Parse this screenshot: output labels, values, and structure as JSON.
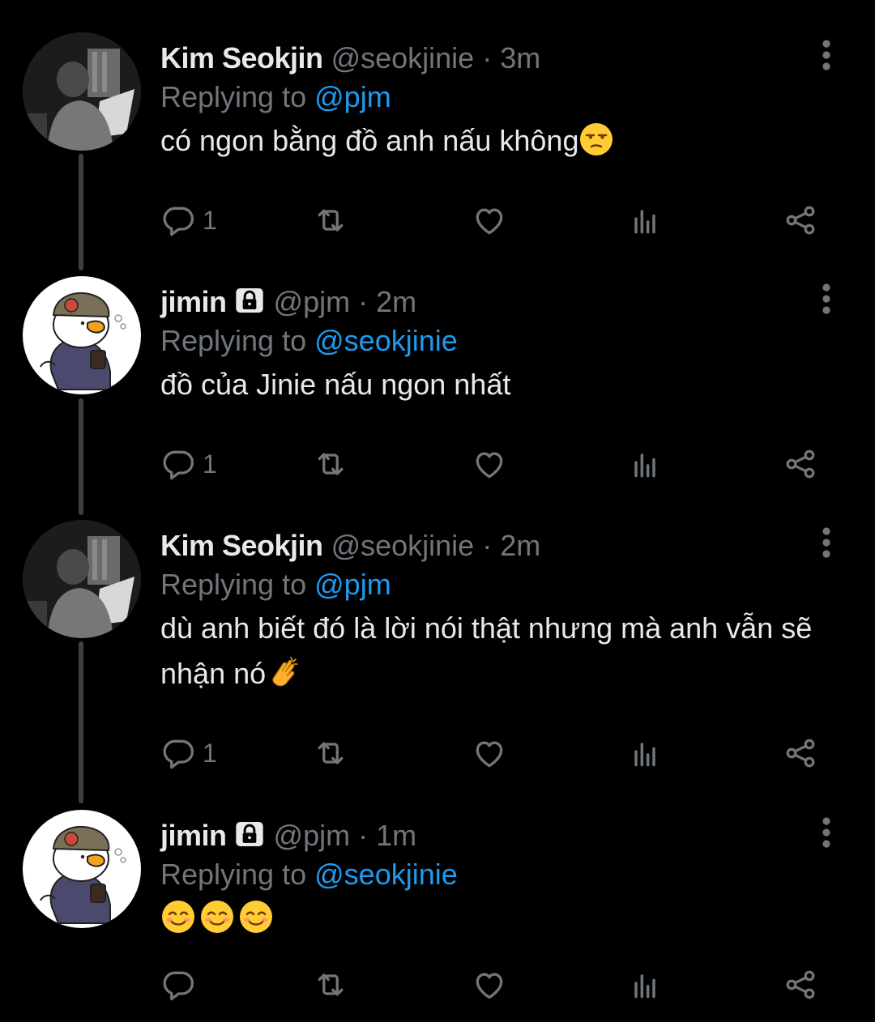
{
  "colors": {
    "background": "#000000",
    "primary_text": "#e7e9ea",
    "secondary_text": "#71767b",
    "mention": "#1d9bf0",
    "thread_line": "#3e4144"
  },
  "tweets": [
    {
      "name": "Kim Seokjin",
      "handle": "@seokjinie",
      "separator": "·",
      "time": "3m",
      "replying_label": "Replying to",
      "replying_to": "@pjm",
      "text": "có ngon bằng đồ anh nấu không",
      "emoji": "unamused-face",
      "reply_count": "1",
      "avatar_icon": "photo-avatar"
    },
    {
      "name": "jimin",
      "protected_icon": "lock-icon",
      "handle": "@pjm",
      "separator": "·",
      "time": "2m",
      "replying_label": "Replying to",
      "replying_to": "@seokjinie",
      "text": "đồ của Jinie nấu ngon nhất",
      "reply_count": "1",
      "avatar_icon": "duck-cartoon-avatar"
    },
    {
      "name": "Kim Seokjin",
      "handle": "@seokjinie",
      "separator": "·",
      "time": "2m",
      "replying_label": "Replying to",
      "replying_to": "@pjm",
      "text": "dù anh biết đó là lời nói thật nhưng mà anh vẫn sẽ nhận nó",
      "emoji": "clapping-hands",
      "reply_count": "1",
      "avatar_icon": "photo-avatar"
    },
    {
      "name": "jimin",
      "protected_icon": "lock-icon",
      "handle": "@pjm",
      "separator": "·",
      "time": "1m",
      "replying_label": "Replying to",
      "replying_to": "@seokjinie",
      "text": "",
      "emoji": "smiling-face x3",
      "reply_count": "",
      "avatar_icon": "duck-cartoon-avatar"
    }
  ]
}
